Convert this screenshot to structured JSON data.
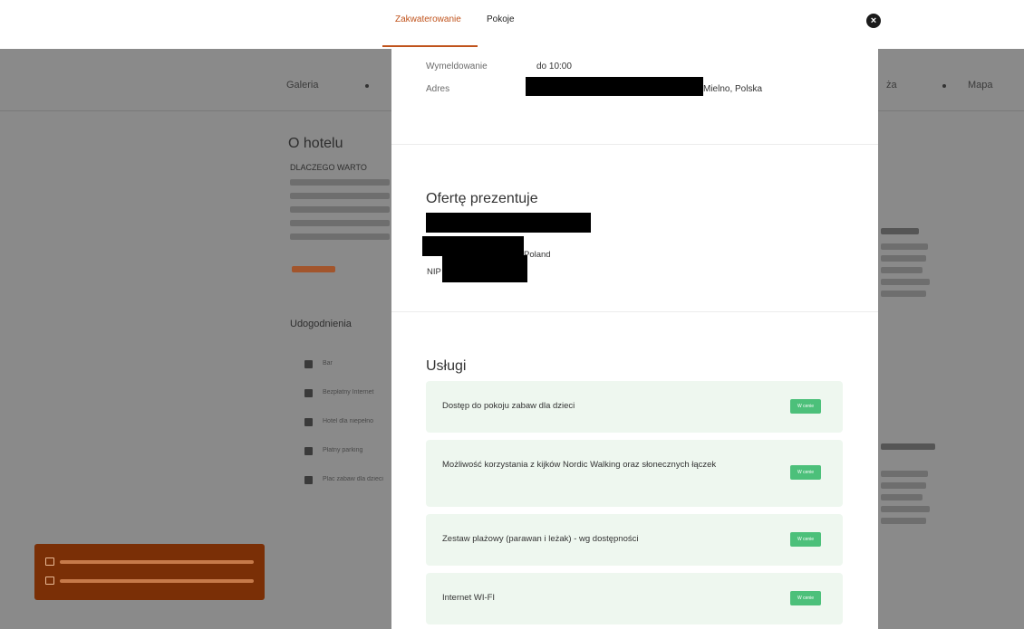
{
  "tabs": [
    {
      "label": "Zakwaterowanie",
      "active": true
    },
    {
      "label": "Pokoje",
      "active": false
    }
  ],
  "close_icon": "close-circle-icon",
  "background_page": {
    "nav": {
      "left": "Galeria",
      "right": "Mapa"
    },
    "section_title": "O hotelu",
    "intro_text": "DLACZEGO WARTO",
    "amenities_title": "Udogodnienia",
    "amenities": [
      {
        "label": "Bar",
        "icon": "bar-icon"
      },
      {
        "label": "Bezpłatny Internet",
        "icon": "wifi-icon"
      },
      {
        "label": "Hotel dla niepełno",
        "icon": "accessible-icon"
      },
      {
        "label": "Płatny parking",
        "icon": "parking-icon"
      },
      {
        "label": "Plac zabaw dla dzieci",
        "icon": "playground-icon"
      }
    ]
  },
  "modal": {
    "checkout": {
      "label": "Wymeldowanie",
      "value": "do 10:00"
    },
    "address": {
      "label": "Adres",
      "value_suffix": "Mielno, Polska"
    },
    "offer": {
      "title": "Ofertę prezentuje",
      "country": "Poland",
      "nip_label": "NIP"
    },
    "services": {
      "title": "Usługi",
      "badge_label": "W cenie",
      "items": [
        {
          "label": "Dostęp do pokoju zabaw dla dzieci"
        },
        {
          "label": "Możliwość korzystania z kijków Nordic Walking oraz słonecznych łączek"
        },
        {
          "label": "Zestaw plażowy (parawan i leżak) - wg dostępności"
        },
        {
          "label": "Internet WI-FI"
        }
      ]
    }
  },
  "colors": {
    "accent": "#c0531c",
    "badge": "#4cc07a",
    "service_bg": "#eef7ef",
    "overlay": "#8a8a8a",
    "toast": "#7a2f06"
  }
}
